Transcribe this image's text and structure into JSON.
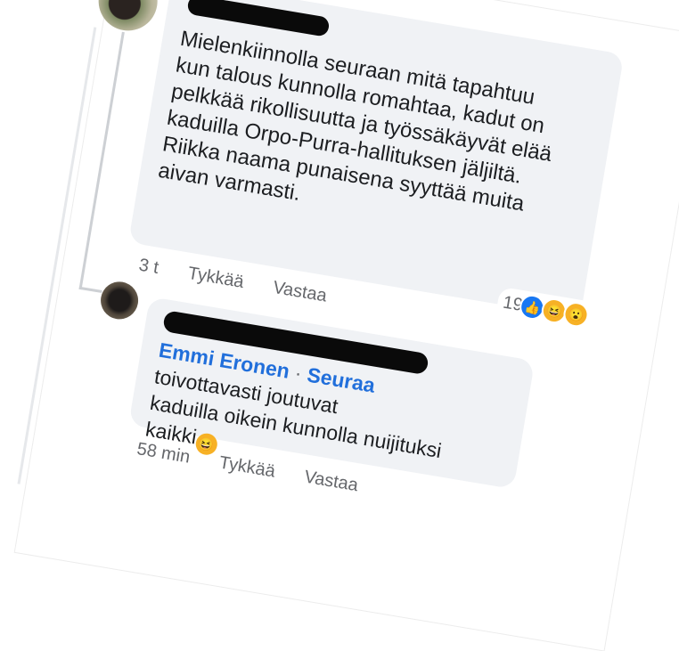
{
  "comment1": {
    "author_redacted": true,
    "text": "Mielenkiinnolla seuraan mitä tapahtuu\nkun talous kunnolla romahtaa, kadut on\npelkkää rikollisuutta ja työssäkäyvät elää\nkaduilla Orpo-Purra-hallituksen jäljiltä.\nRiikka naama punaisena syyttää muita\naivan varmasti.",
    "time": "3 t",
    "like_label": "Tykkää",
    "reply_label": "Vastaa",
    "reaction_count": "19",
    "reactions": [
      "like-icon",
      "haha-icon",
      "wow-icon"
    ]
  },
  "comment2": {
    "author_redacted": true,
    "mentioned_user": "Emmi Eronen",
    "separator": "·",
    "follow_label": "Seuraa",
    "text": "toivottavasti joutuvat\nkaduilla oikein kunnolla nuijituksi\nkaikki",
    "time": "58 min",
    "like_label": "Tykkää",
    "reply_label": "Vastaa"
  },
  "colors": {
    "link": "#216fdb",
    "bubble": "#f0f2f5",
    "meta": "#65676b"
  }
}
